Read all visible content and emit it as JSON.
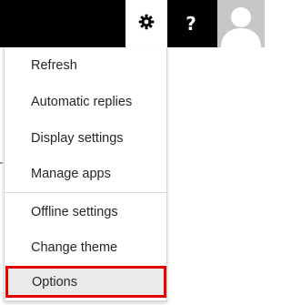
{
  "topbar": {
    "settings_icon": "gear-icon",
    "help_icon": "question-mark-icon",
    "help_glyph": "?",
    "avatar_icon": "person-silhouette-icon"
  },
  "menu": {
    "items": [
      {
        "label": "Refresh"
      },
      {
        "label": "Automatic replies"
      },
      {
        "label": "Display settings"
      },
      {
        "label": "Manage apps"
      },
      {
        "label": "Offline settings"
      },
      {
        "label": "Change theme"
      },
      {
        "label": "Options"
      }
    ],
    "highlighted_item": "Options"
  },
  "colors": {
    "topbar": "#000000",
    "highlight_border": "#e60000",
    "highlight_fill": "#eaeaea",
    "text": "#262626"
  }
}
